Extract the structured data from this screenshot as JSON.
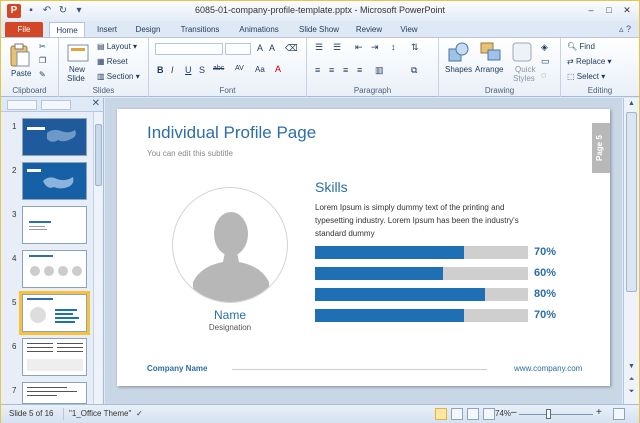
{
  "app": {
    "title": "6085-01-company-profile-template.pptx - Microsoft PowerPoint",
    "logo_letter": "P",
    "window_controls": [
      "–",
      "□",
      "✕"
    ]
  },
  "tabs": [
    "File",
    "Home",
    "Insert",
    "Design",
    "Transitions",
    "Animations",
    "Slide Show",
    "Review",
    "View"
  ],
  "active_tab": "Home",
  "ribbon": {
    "clipboard": {
      "paste": "Paste",
      "label": "Clipboard"
    },
    "slides": {
      "new_slide": "New",
      "new_slide2": "Slide",
      "layout": "Layout",
      "reset": "Reset",
      "section": "Section",
      "label": "Slides"
    },
    "font": {
      "bold": "B",
      "italic": "I",
      "underline": "U",
      "shadow": "S",
      "strike": "abc",
      "spacing": "AV",
      "case": "Aa",
      "color": "A",
      "label": "Font"
    },
    "paragraph": {
      "label": "Paragraph"
    },
    "drawing": {
      "shapes": "Shapes",
      "arrange": "Arrange",
      "quick_styles": "Quick",
      "quick_styles2": "Styles",
      "label": "Drawing"
    },
    "editing": {
      "find": "Find",
      "replace": "Replace",
      "select": "Select",
      "label": "Editing"
    }
  },
  "thumbnails": [
    {
      "num": "1"
    },
    {
      "num": "2"
    },
    {
      "num": "3"
    },
    {
      "num": "4"
    },
    {
      "num": "5"
    },
    {
      "num": "6"
    },
    {
      "num": "7"
    }
  ],
  "selected_slide": 5,
  "slide": {
    "title": "Individual Profile Page",
    "subtitle": "You can edit this subtitle",
    "page_tab": "Page 5",
    "profile": {
      "name": "Name",
      "designation": "Designation"
    },
    "skills_title": "Skills",
    "skills_text": "Lorem Ipsum is simply dummy text of the printing and typesetting industry. Lorem Ipsum has been the industry's standard dummy",
    "skills": [
      {
        "pct": "70%",
        "value": 0.7
      },
      {
        "pct": "60%",
        "value": 0.6
      },
      {
        "pct": "80%",
        "value": 0.8
      },
      {
        "pct": "70%",
        "value": 0.7
      }
    ],
    "footer_company": "Company Name",
    "footer_web": "www.company.com"
  },
  "colors": {
    "accent": "#2c6ea7",
    "bar_fill": "#1f6fb5",
    "bar_track": "#cfcfcf",
    "file_tab": "#d24726"
  },
  "status": {
    "slide_info": "Slide 5 of 16",
    "theme": "\"1_Office Theme\"",
    "zoom": "74%",
    "zoom_minus": "–",
    "zoom_plus": "+"
  }
}
